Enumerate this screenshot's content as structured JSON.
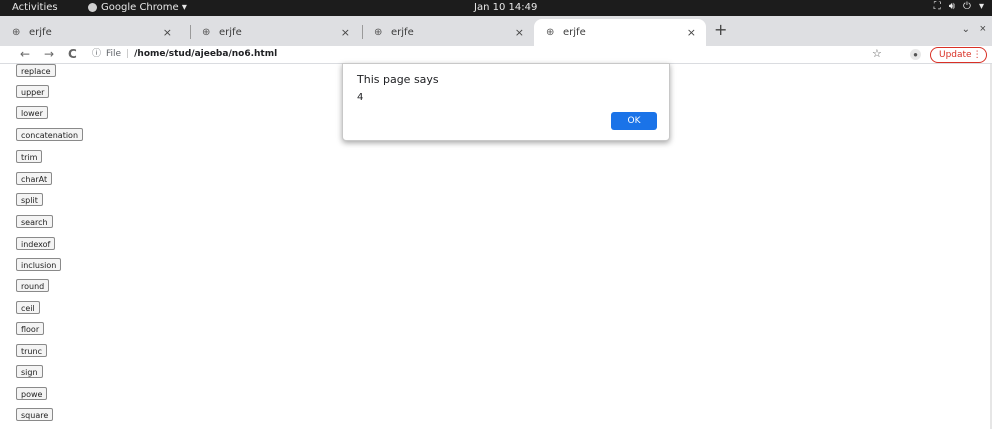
{
  "topbar": {
    "activities": "Activities",
    "app_name": "Google Chrome ▾",
    "clock": "Jan 10  14:49",
    "icons": [
      "network-icon",
      "volume-icon",
      "power-icon",
      "menu-arrow-icon"
    ]
  },
  "tabs": [
    {
      "title": "erjfe",
      "active": false
    },
    {
      "title": "erjfe",
      "active": false
    },
    {
      "title": "erjfe",
      "active": false
    },
    {
      "title": "erjfe",
      "active": true
    }
  ],
  "tab_close_glyph": "×",
  "toolbar": {
    "back": "←",
    "forward": "→",
    "reload": "C",
    "info": "ⓘ",
    "url_scheme_label": "File",
    "url_path": "/home/stud/ajeeba/no6.html",
    "star": "☆",
    "update_label": "Update"
  },
  "buttons": [
    "replace",
    "upper",
    "lower",
    "concatenation",
    "trim",
    "charAt",
    "split",
    "search",
    "indexof",
    "inclusion",
    "round",
    "ceil",
    "floor",
    "trunc",
    "sign",
    "powe",
    "square"
  ],
  "dialog": {
    "title": "This page says",
    "message": "4",
    "ok_label": "OK"
  },
  "colors": {
    "accent": "#1a73e8",
    "update": "#d93025",
    "topbar": "#1c1c1c",
    "tabstrip": "#dedfe2"
  }
}
